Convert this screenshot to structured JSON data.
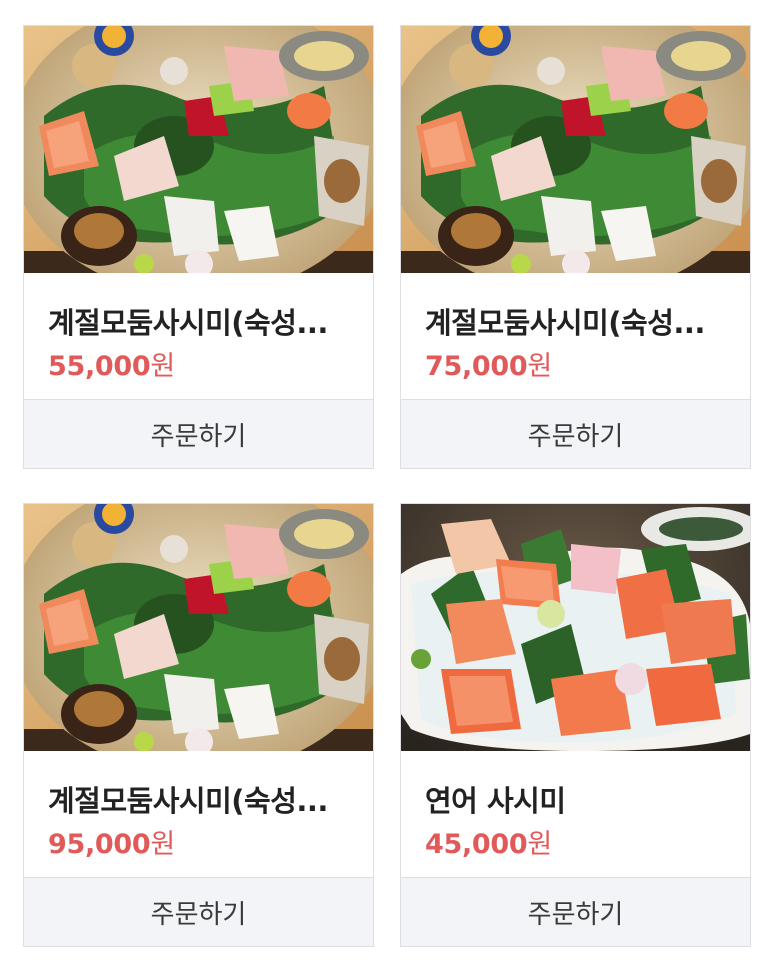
{
  "products": [
    {
      "name": "계절모둠사시미(숙성...",
      "price_number": "55,000",
      "price_unit": "원",
      "order_label": "주문하기",
      "image": "assorted-sashimi-platter"
    },
    {
      "name": "계절모둠사시미(숙성...",
      "price_number": "75,000",
      "price_unit": "원",
      "order_label": "주문하기",
      "image": "assorted-sashimi-platter"
    },
    {
      "name": "계절모둠사시미(숙성...",
      "price_number": "95,000",
      "price_unit": "원",
      "order_label": "주문하기",
      "image": "assorted-sashimi-platter"
    },
    {
      "name": "연어 사시미",
      "price_number": "45,000",
      "price_unit": "원",
      "order_label": "주문하기",
      "image": "salmon-sashimi"
    }
  ],
  "colors": {
    "price": "#e15a5a",
    "name": "#222222",
    "order_bg": "#f3f4f7",
    "border": "#dedee3"
  }
}
